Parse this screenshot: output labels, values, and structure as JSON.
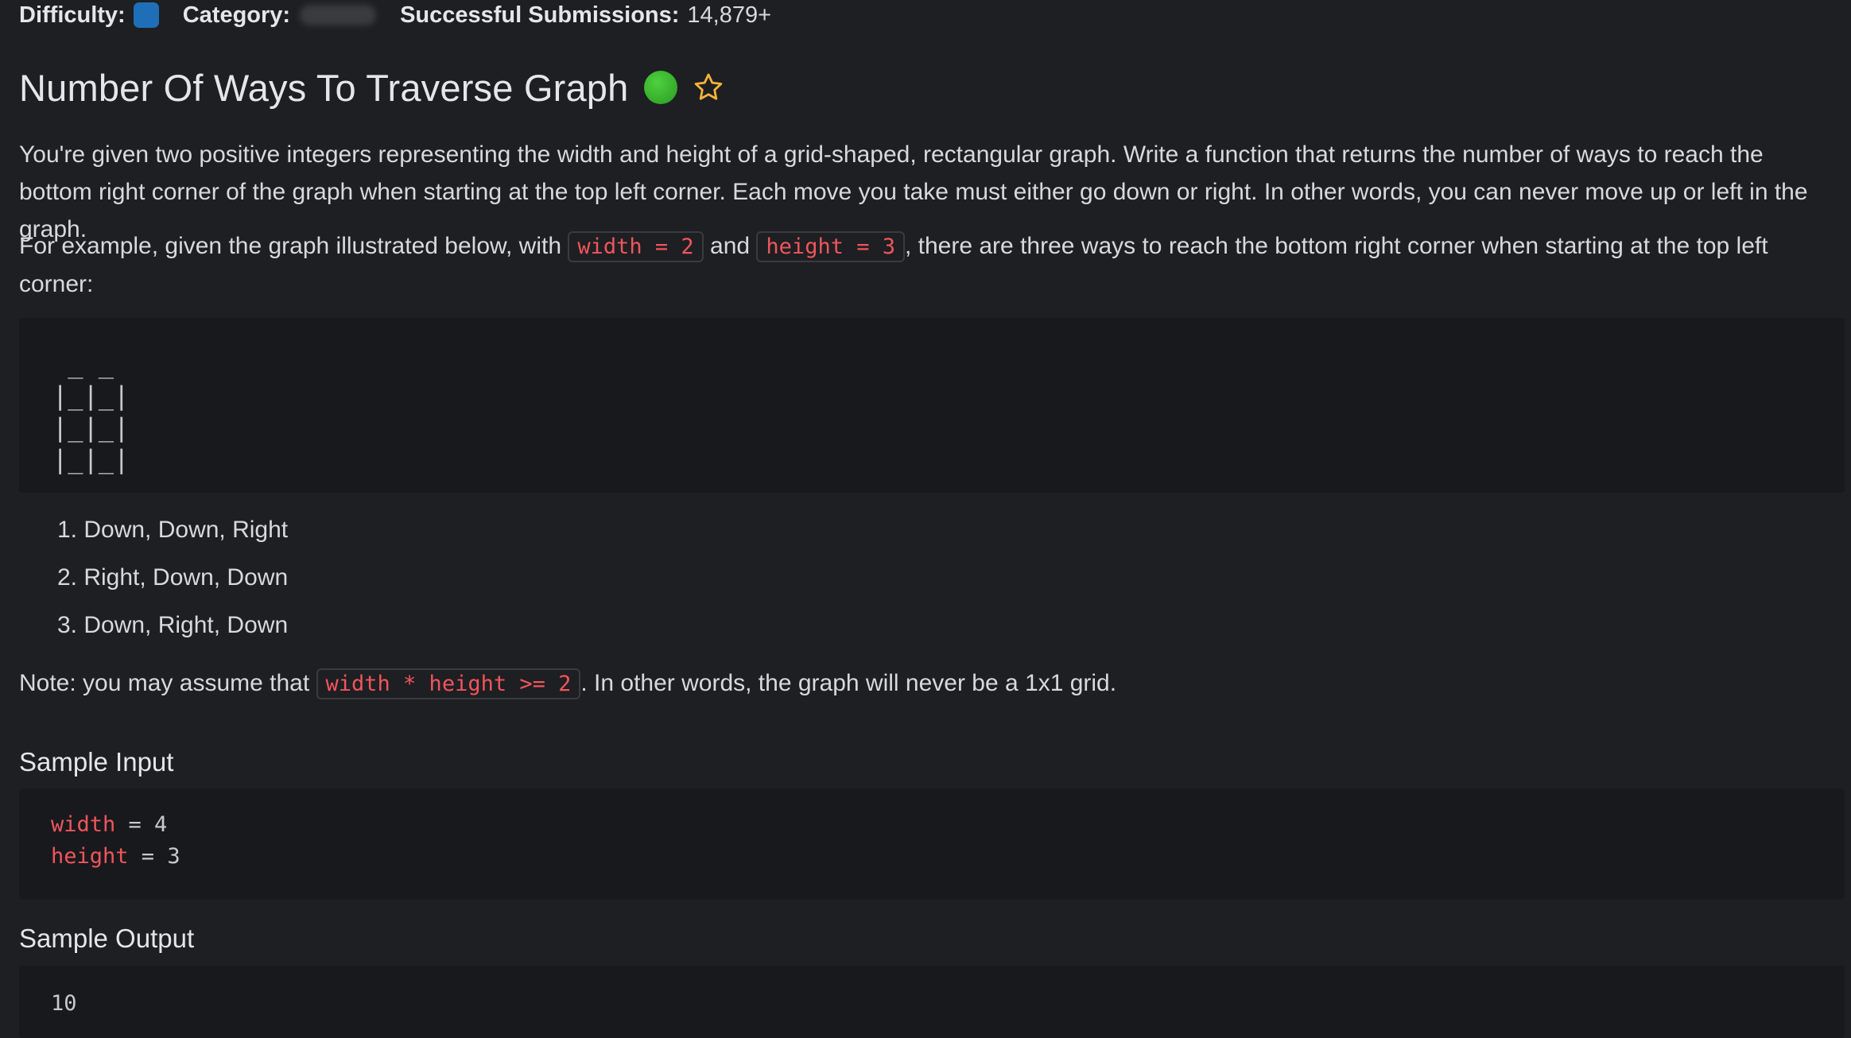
{
  "meta": {
    "difficulty_label": "Difficulty:",
    "category_label": "Category:",
    "submissions_label": "Successful Submissions:",
    "submissions_value": "14,879+"
  },
  "colors": {
    "difficulty": "#1f6fb8",
    "status": "#3bbf2e",
    "star": "#f5b43a",
    "code_red": "#f0555d"
  },
  "icons": {
    "status": "green-dot-icon",
    "favorite": "star-outline-icon"
  },
  "title": "Number Of Ways To Traverse Graph",
  "paragraph1": "You're given two positive integers representing the width and height of a grid-shaped, rectangular graph. Write a function that returns the number of ways to reach the bottom right corner of the graph when starting at the top left corner. Each move you take must either go down or right. In other words, you can never move up or left in the graph.",
  "paragraph2": {
    "pre": "For example, given the graph illustrated below, with ",
    "code1": "width = 2",
    "mid": " and ",
    "code2": "height = 3",
    "post": ", there are three ways to reach the bottom right corner when starting at the top left corner:"
  },
  "grid_art": " _ _\n|_|_|\n|_|_|\n|_|_|",
  "ways": [
    "1. Down, Down, Right",
    "2. Right, Down, Down",
    "3. Down, Right, Down"
  ],
  "note": {
    "pre": "Note: you may assume that ",
    "code": "width * height >= 2",
    "post": ". In other words, the graph will never be a 1x1 grid."
  },
  "sample_input": {
    "title": "Sample Input",
    "line1_var": "width",
    "line1_rest": " = 4",
    "line2_var": "height",
    "line2_rest": " = 3"
  },
  "sample_output": {
    "title": "Sample Output",
    "value": "10"
  }
}
